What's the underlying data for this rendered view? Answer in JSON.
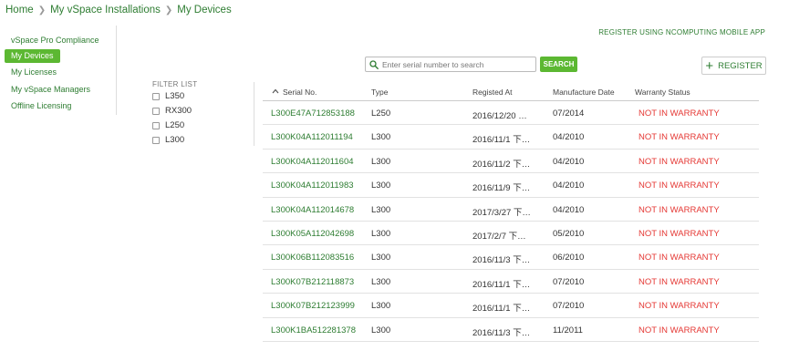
{
  "breadcrumb": {
    "items": [
      "Home",
      "My vSpace Installations",
      "My Devices"
    ]
  },
  "sidebar": {
    "items": [
      {
        "label": "vSpace Pro Compliance"
      },
      {
        "label": "My Devices",
        "active": true
      },
      {
        "label": "My Licenses"
      },
      {
        "label": "My vSpace Managers"
      },
      {
        "label": "Offline Licensing"
      }
    ]
  },
  "filter": {
    "title": "FILTER LIST",
    "options": [
      "L350",
      "RX300",
      "L250",
      "L300"
    ]
  },
  "register_app_link": "REGISTER USING NCOMPUTING MOBILE APP",
  "search": {
    "placeholder": "Enter serial number to search",
    "button": "SEARCH"
  },
  "register_button": "REGISTER",
  "table": {
    "headers": [
      "Serial No.",
      "Type",
      "Registed At",
      "Manufacture Date",
      "Warranty Status"
    ],
    "rows": [
      [
        "L300E47A712853188",
        "L250",
        "2016/12/20 下午...",
        "07/2014",
        "NOT IN WARRANTY"
      ],
      [
        "L300K04A112011194",
        "L300",
        "2016/11/1 下午...",
        "04/2010",
        "NOT IN WARRANTY"
      ],
      [
        "L300K04A112011604",
        "L300",
        "2016/11/2 下午...",
        "04/2010",
        "NOT IN WARRANTY"
      ],
      [
        "L300K04A112011983",
        "L300",
        "2016/11/9 下午...",
        "04/2010",
        "NOT IN WARRANTY"
      ],
      [
        "L300K04A112014678",
        "L300",
        "2017/3/27 下午...",
        "04/2010",
        "NOT IN WARRANTY"
      ],
      [
        "L300K05A112042698",
        "L300",
        "2017/2/7 下午6...",
        "05/2010",
        "NOT IN WARRANTY"
      ],
      [
        "L300K06B112083516",
        "L300",
        "2016/11/3 下午...",
        "06/2010",
        "NOT IN WARRANTY"
      ],
      [
        "L300K07B212118873",
        "L300",
        "2016/11/1 下午...",
        "07/2010",
        "NOT IN WARRANTY"
      ],
      [
        "L300K07B212123999",
        "L300",
        "2016/11/1 下午...",
        "07/2010",
        "NOT IN WARRANTY"
      ],
      [
        "L300K1BA512281378",
        "L300",
        "2016/11/3 下午...",
        "11/2011",
        "NOT IN WARRANTY"
      ]
    ]
  },
  "colors": {
    "accent_green": "#5cb832",
    "link_green": "#2e7d32",
    "warning_red": "#e53935"
  },
  "icons": {
    "search": "search-icon",
    "sort": "sort-up-icon",
    "plus": "plus-icon",
    "separator": "chevron-right-icon"
  }
}
